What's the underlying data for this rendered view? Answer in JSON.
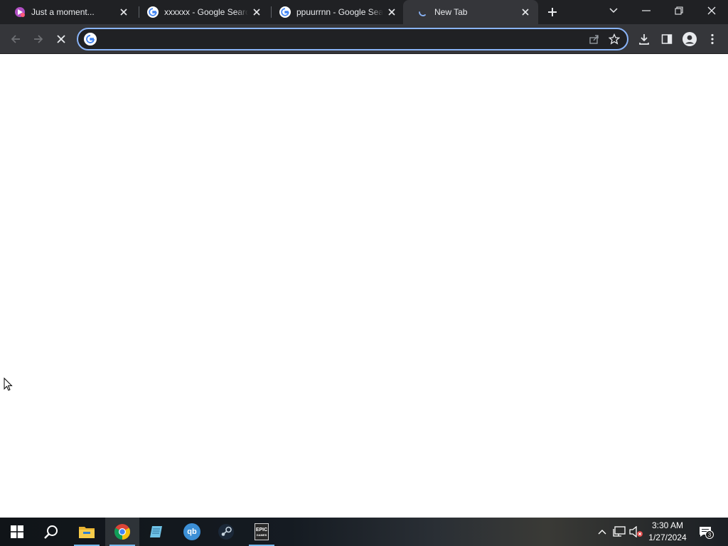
{
  "browser": {
    "tabs": [
      {
        "title": "Just a moment...",
        "favicon": "ad-site-icon"
      },
      {
        "title": "xxxxxx - Google Search",
        "favicon": "google-g-icon"
      },
      {
        "title": "ppuurrnn - Google Search",
        "favicon": "google-g-icon"
      },
      {
        "title": "New Tab",
        "favicon": "loading-spinner-icon",
        "active": true
      }
    ],
    "omnibox": {
      "value": "",
      "placeholder": ""
    },
    "colors": {
      "frame": "#202124",
      "toolbar": "#35363a",
      "focus_ring": "#8ab4f8",
      "text": "#e8eaed"
    }
  },
  "taskbar": {
    "apps": [
      {
        "name": "file-explorer-icon"
      },
      {
        "name": "chrome-icon",
        "active": true
      },
      {
        "name": "notepad-icon"
      },
      {
        "name": "qbittorrent-icon",
        "label": "qb"
      },
      {
        "name": "steam-icon"
      },
      {
        "name": "epic-games-icon",
        "label": "EPIC",
        "sublabel": "GAMES"
      }
    ],
    "clock": {
      "time": "3:30 AM",
      "date": "1/27/2024"
    },
    "notification_count": "3"
  }
}
